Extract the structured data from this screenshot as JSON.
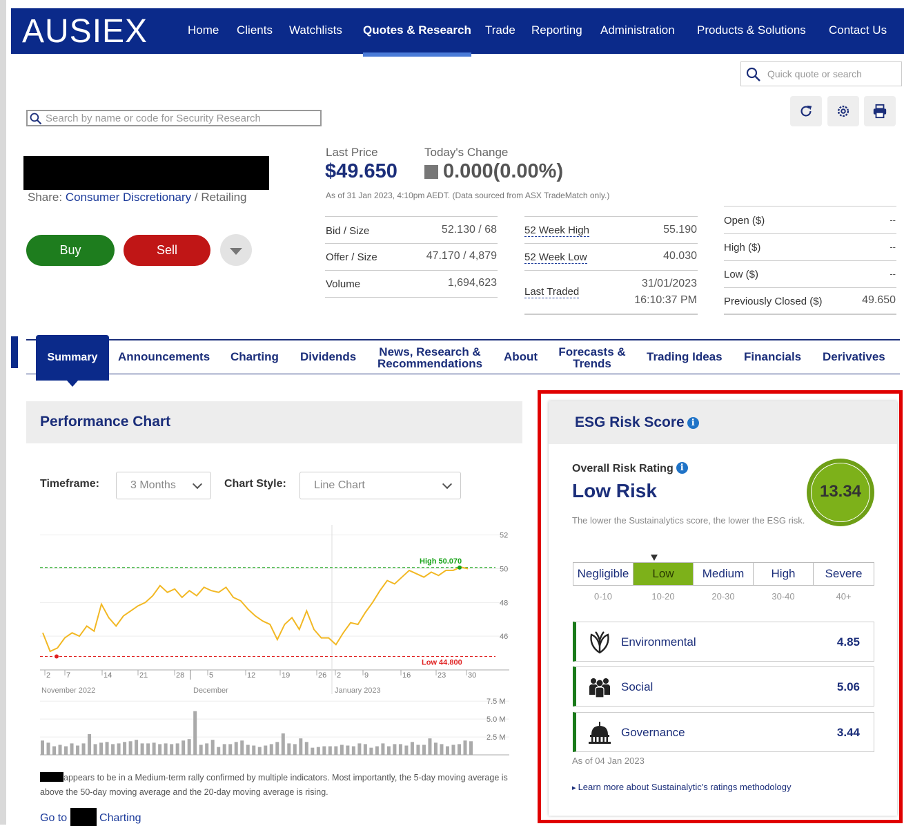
{
  "brand": {
    "logo": "AUSIEX",
    "nav_bg": "#0b2a8a",
    "accent": "#1b2e7a"
  },
  "nav": {
    "items": [
      "Home",
      "Clients",
      "Watchlists",
      "Quotes & Research",
      "Trade",
      "Reporting",
      "Administration",
      "Products & Solutions",
      "Contact Us"
    ],
    "active": "Quotes & Research"
  },
  "quick_search": {
    "placeholder": "Quick quote or search"
  },
  "security_search": {
    "placeholder": "Search by name or code for Security Research"
  },
  "toolbar": {
    "icons": [
      "refresh-icon",
      "settings-icon",
      "print-icon"
    ]
  },
  "share": {
    "prefix": "Share:",
    "sector": "Consumer Discretionary",
    "separator": " / ",
    "industry": "Retailing"
  },
  "actions": {
    "buy": "Buy",
    "sell": "Sell"
  },
  "price": {
    "last_label": "Last Price",
    "last_value": "$49.650",
    "change_label": "Today's Change",
    "change_value": "0.000(0.00%)",
    "as_of": "As of 31 Jan 2023, 4:10pm AEDT. (Data sourced from ASX TradeMatch only.)"
  },
  "quote": {
    "bid_label": "Bid / Size",
    "bid_value": "52.130 / 68",
    "offer_label": "Offer / Size",
    "offer_value": "47.170 / 4,879",
    "volume_label": "Volume",
    "volume_value": "1,694,623",
    "high52_label": "52 Week High",
    "high52_value": "55.190",
    "low52_label": "52 Week Low",
    "low52_value": "40.030",
    "last_traded_label": "Last Traded",
    "last_traded_date": "31/01/2023",
    "last_traded_time": "16:10:37 PM",
    "open_label": "Open ($)",
    "open_value": "--",
    "high_label": "High ($)",
    "high_value": "--",
    "low_label": "Low ($)",
    "low_value": "--",
    "prev_label": "Previously Closed ($)",
    "prev_value": "49.650"
  },
  "tabs": {
    "summary": "Summary",
    "announcements": "Announcements",
    "charting": "Charting",
    "dividends": "Dividends",
    "news_1": "News, Research &",
    "news_2": "Recommendations",
    "about": "About",
    "forecasts_1": "Forecasts &",
    "forecasts_2": "Trends",
    "trading_ideas": "Trading Ideas",
    "financials": "Financials",
    "derivatives": "Derivatives",
    "active": "Summary"
  },
  "performance": {
    "title": "Performance Chart",
    "timeframe_label": "Timeframe:",
    "timeframe_value": "3 Months",
    "style_label": "Chart Style:",
    "style_value": "Line Chart",
    "commentary": "appears to be in a Medium-term rally confirmed by multiple indicators. Most importantly, the 5-day moving average is above the 50-day moving average and the 20-day moving average is rising.",
    "goto_prefix": "Go to",
    "goto_suffix": "Charting"
  },
  "chart_data": {
    "type": "line",
    "price_ticks": [
      "52",
      "50",
      "48",
      "46"
    ],
    "ylim": [
      44,
      52.6
    ],
    "high_label": "High 50.070",
    "high": 50.07,
    "low_label": "Low 44.800",
    "low": 44.8,
    "line_color": "#f2b824",
    "x_ticks": [
      "2",
      "7",
      "14",
      "21",
      "28",
      "5",
      "12",
      "19",
      "26",
      "2",
      "9",
      "16",
      "23",
      "30"
    ],
    "month_labels": [
      "November 2022",
      "December",
      "January 2023"
    ],
    "prices": [
      46.2,
      45.1,
      45.3,
      45.9,
      46.2,
      46.0,
      46.6,
      46.3,
      47.9,
      47.1,
      46.6,
      47.2,
      47.5,
      47.8,
      48.0,
      48.4,
      49.0,
      48.6,
      48.8,
      48.3,
      48.7,
      48.4,
      48.9,
      48.7,
      48.6,
      48.9,
      48.3,
      48.1,
      47.6,
      47.2,
      46.9,
      46.7,
      45.8,
      46.7,
      47.1,
      46.4,
      47.5,
      46.4,
      45.9,
      45.9,
      45.5,
      46.2,
      46.8,
      46.7,
      47.4,
      48.0,
      48.7,
      49.3,
      49.1,
      49.5,
      49.9,
      49.7,
      49.5,
      49.8,
      49.6,
      49.9,
      49.9,
      50.1,
      50.0
    ],
    "volume_ticks": [
      "7.5 M",
      "5.0 M",
      "2.5 M"
    ],
    "volume_max": 8.0,
    "volumes": [
      2.0,
      1.7,
      1.2,
      1.4,
      1.2,
      1.6,
      1.3,
      1.6,
      2.9,
      1.5,
      1.7,
      1.8,
      1.5,
      1.6,
      1.8,
      1.9,
      2.1,
      1.6,
      1.6,
      1.7,
      1.5,
      1.6,
      1.5,
      1.6,
      2.0,
      2.2,
      6.1,
      1.4,
      1.6,
      2.1,
      1.1,
      1.5,
      1.5,
      1.8,
      2.0,
      1.4,
      1.3,
      1.1,
      1.3,
      1.5,
      1.8,
      3.0,
      1.6,
      1.5,
      2.3,
      1.8,
      1.0,
      1.1,
      1.2,
      1.2,
      1.2,
      1.4,
      1.3,
      1.2,
      1.6,
      1.5,
      1.0,
      1.2,
      1.6,
      1.2,
      1.5,
      1.5,
      1.3,
      1.8,
      1.4,
      1.4,
      2.3,
      1.7,
      1.5,
      1.2,
      1.4,
      1.5,
      2.0,
      1.9
    ]
  },
  "esg": {
    "title": "ESG Risk Score",
    "overall_label": "Overall Risk Rating",
    "rating": "Low Risk",
    "score": "13.34",
    "score_color": "#7db11a",
    "description": "The lower the Sustainalytics score, the lower the ESG risk.",
    "scale": [
      {
        "label": "Negligible",
        "range": "0-10"
      },
      {
        "label": "Low",
        "range": "10-20"
      },
      {
        "label": "Medium",
        "range": "20-30"
      },
      {
        "label": "High",
        "range": "30-40"
      },
      {
        "label": "Severe",
        "range": "40+"
      }
    ],
    "selected": "Low",
    "pillars": [
      {
        "name": "Environmental",
        "score": "4.85",
        "icon": "leaf-icon"
      },
      {
        "name": "Social",
        "score": "5.06",
        "icon": "people-icon"
      },
      {
        "name": "Governance",
        "score": "3.44",
        "icon": "capitol-icon"
      }
    ],
    "as_of": "As of 04 Jan 2023",
    "learn_more": "Learn more about Sustainalytic's ratings methodology",
    "highlight_color": "#e00000"
  }
}
